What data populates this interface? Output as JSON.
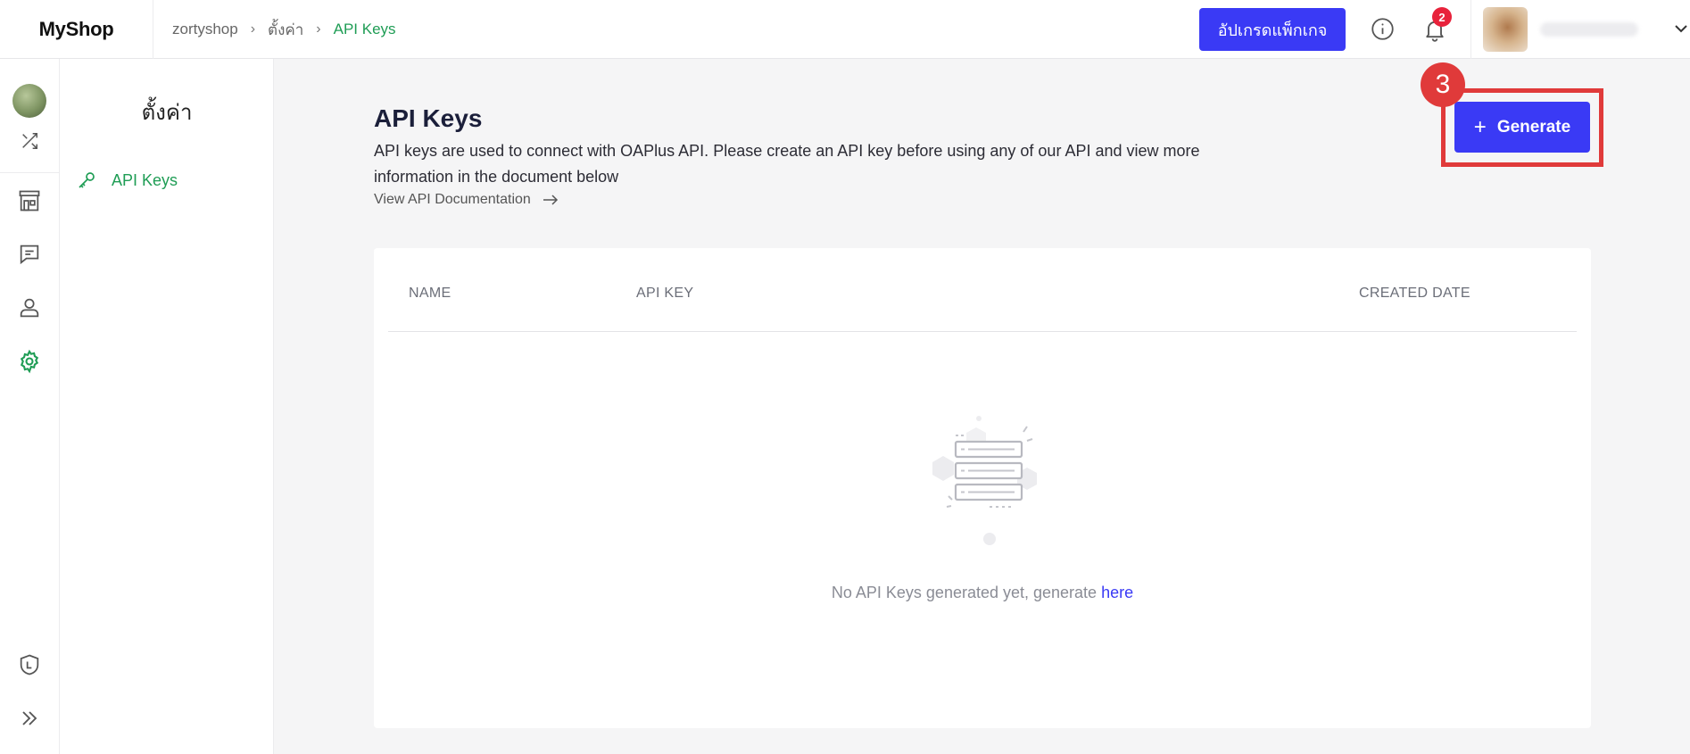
{
  "brand": "MyShop",
  "breadcrumb": {
    "shop": "zortyshop",
    "settings": "ตั้งค่า",
    "current": "API Keys"
  },
  "header": {
    "upgrade_label": "อัปเกรดแพ็กเกจ",
    "notification_count": "2"
  },
  "settings_panel": {
    "title": "ตั้งค่า",
    "items": [
      {
        "label": "API Keys"
      }
    ]
  },
  "main": {
    "title": "API Keys",
    "description": "API keys are used to connect with OAPlus API. Please create an API key before using any of our API and view more information in the document below",
    "doc_link": "View API Documentation",
    "generate_label": "Generate",
    "step_number": "3"
  },
  "table": {
    "columns": [
      "NAME",
      "API KEY",
      "CREATED DATE"
    ],
    "empty_text": "No API Keys generated yet, generate",
    "empty_link": "here"
  },
  "colors": {
    "primary": "#3a3af5",
    "accent_green": "#1f9d55",
    "highlight_red": "#e03a3a",
    "badge_red": "#e8223b"
  }
}
